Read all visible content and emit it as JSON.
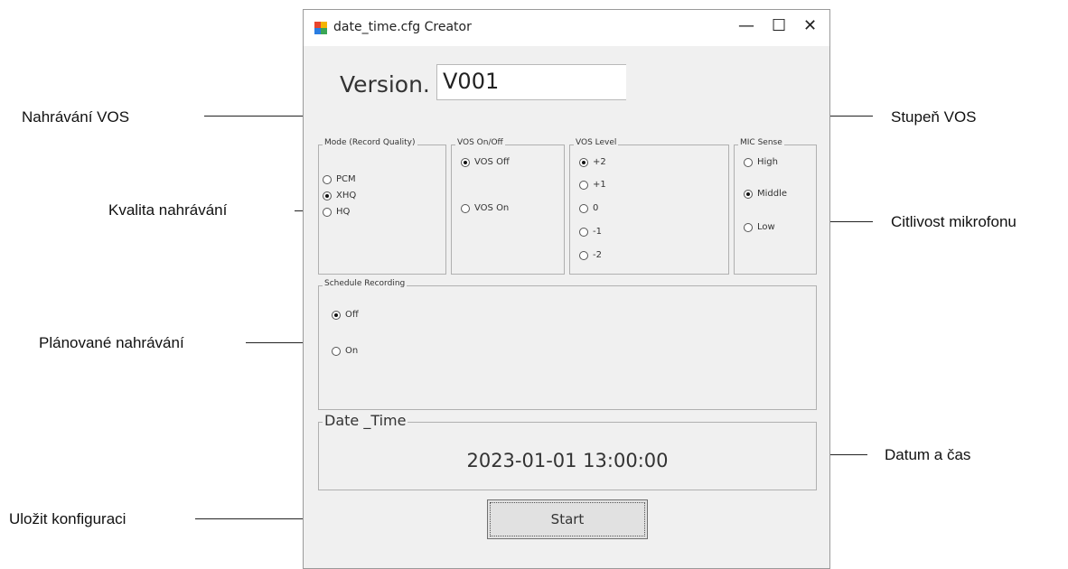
{
  "window": {
    "title": "date_time.cfg Creator",
    "controls": {
      "minimize": "—",
      "maximize": "☐",
      "close": "✕"
    }
  },
  "version": {
    "label": "Version.",
    "value": "V001"
  },
  "groups": {
    "mode": {
      "title": "Mode (Record Quality)",
      "options": [
        "PCM",
        "XHQ",
        "HQ"
      ],
      "selected": "XHQ"
    },
    "vos": {
      "title": "VOS On/Off",
      "options": [
        "VOS Off",
        "VOS On"
      ],
      "selected": "VOS Off"
    },
    "vos_level": {
      "title": "VOS Level",
      "options": [
        "+2",
        "+1",
        "0",
        "-1",
        "-2"
      ],
      "selected": "+2"
    },
    "mic": {
      "title": "MIC Sense",
      "options": [
        "High",
        "Middle",
        "Low"
      ],
      "selected": "Middle"
    },
    "schedule": {
      "title": "Schedule Recording",
      "options": [
        "Off",
        "On"
      ],
      "selected": "Off"
    },
    "date_time": {
      "title": "Date _Time",
      "value": "2023-01-01 13:00:00"
    }
  },
  "start_button": "Start",
  "annotations": {
    "vos_recording": "Nahrávání VOS",
    "vos_level": "Stupeň VOS",
    "record_quality": "Kvalita nahrávání",
    "mic_sensitivity": "Citlivost mikrofonu",
    "scheduled_recording": "Plánované nahrávání",
    "date_time": "Datum a čas",
    "save_config": "Uložit konfiguraci"
  },
  "colors": {
    "window_bg": "#f0f0f0",
    "titlebar_bg": "#ffffff",
    "icon": [
      "#e8452c",
      "#f5b400",
      "#2a7de1",
      "#3aa655"
    ]
  }
}
